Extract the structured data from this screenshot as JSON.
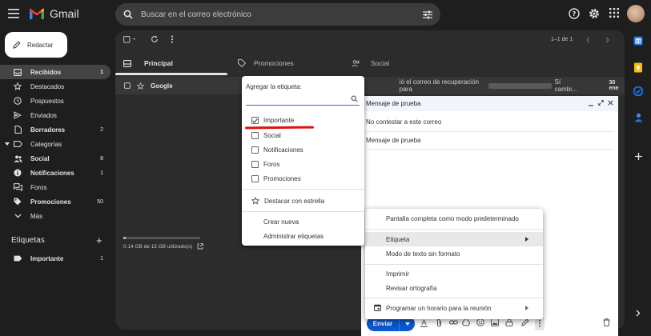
{
  "header": {
    "app_name": "Gmail",
    "search_placeholder": "Buscar en el correo electrónico"
  },
  "compose_button": {
    "label": "Redactar"
  },
  "sidebar": {
    "items": [
      {
        "label": "Recibidos",
        "count": "1"
      },
      {
        "label": "Destacados",
        "count": ""
      },
      {
        "label": "Pospuestos",
        "count": ""
      },
      {
        "label": "Enviados",
        "count": ""
      },
      {
        "label": "Borradores",
        "count": "2"
      },
      {
        "label": "Categorías",
        "count": ""
      },
      {
        "label": "Social",
        "count": "8"
      },
      {
        "label": "Notificaciones",
        "count": "1"
      },
      {
        "label": "Foros",
        "count": ""
      },
      {
        "label": "Promociones",
        "count": "50"
      },
      {
        "label": "Más",
        "count": ""
      }
    ],
    "labels_title": "Etiquetas",
    "labels": [
      {
        "label": "Importante",
        "count": "1"
      }
    ]
  },
  "toolbar": {
    "pagination": "1–1 de 1"
  },
  "tabs": [
    {
      "label": "Principal"
    },
    {
      "label": "Promociones"
    },
    {
      "label": "Social"
    }
  ],
  "mail_list": [
    {
      "sender": "Google",
      "snippet": "ió el correo de recuperación para",
      "snippet_end": "Sí cambi...",
      "date": "30 ene"
    }
  ],
  "storage": {
    "text": "0.14 GB de 15 GB utilizado(s)",
    "used_fraction": 0.01
  },
  "label_menu": {
    "title": "Agregar la etiqueta:",
    "input_value": "",
    "options": [
      {
        "label": "Importante",
        "checked": true
      },
      {
        "label": "Social",
        "checked": false
      },
      {
        "label": "Notificaciones",
        "checked": false
      },
      {
        "label": "Foros",
        "checked": false
      },
      {
        "label": "Promociones",
        "checked": false
      }
    ],
    "star_label": "Destacar con estrella",
    "create_label": "Crear nueva",
    "manage_label": "Administrar etiquetas"
  },
  "compose_window": {
    "title": "Mensaje de prueba",
    "to": "No contestar a este correo",
    "subject": "Mensaje de prueba",
    "send_label": "Enviar"
  },
  "context_menu": {
    "items": [
      {
        "label": "Pantalla completa como modo predeterminado"
      },
      {
        "label": "Etiqueta"
      },
      {
        "label": "Modo de texto sin formato"
      },
      {
        "label": "Imprimir"
      },
      {
        "label": "Revisar ortografía"
      },
      {
        "label": "Programar un horario para la reunión"
      }
    ]
  },
  "colors": {
    "accent": "#0b57d0",
    "highlight_line": "#e01010",
    "bg": "#1e1e1e"
  }
}
